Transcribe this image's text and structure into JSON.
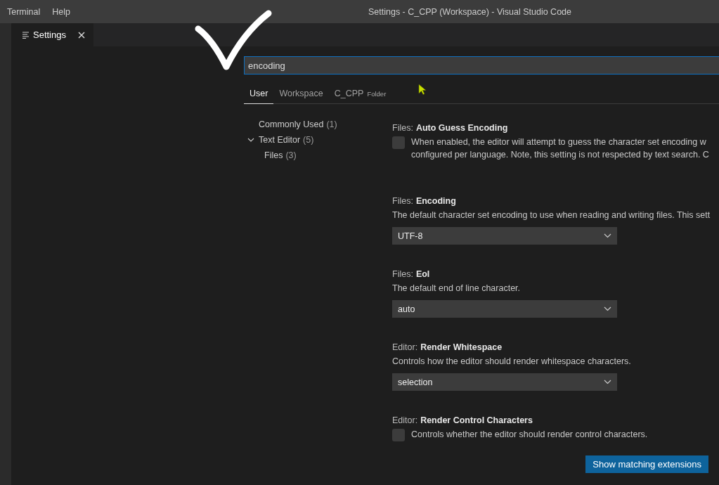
{
  "window": {
    "title": "Settings - C_CPP (Workspace) - Visual Studio Code"
  },
  "menu": [
    "Terminal",
    "Help"
  ],
  "editor_tabs": [
    {
      "label": "Settings",
      "selected": true
    }
  ],
  "search": {
    "value": "encoding"
  },
  "scope_tabs": [
    {
      "label": "User",
      "selected": true
    },
    {
      "label": "Workspace",
      "selected": false
    },
    {
      "label": "C_CPP",
      "badge": "Folder",
      "selected": false
    }
  ],
  "toc": [
    {
      "label": "Commonly Used",
      "count": "(1)"
    },
    {
      "label": "Text Editor",
      "count": "(5)",
      "expanded": true,
      "children": [
        {
          "label": "Files",
          "count": "(3)"
        }
      ]
    }
  ],
  "settings": [
    {
      "kind": "checkbox",
      "category": "Files:",
      "name": "Auto Guess Encoding",
      "description": "When enabled, the editor will attempt to guess the character set encoding w configured per language. Note, this setting is not respected by text search. C",
      "checked": false
    },
    {
      "kind": "dropdown",
      "category": "Files:",
      "name": "Encoding",
      "description": "The default character set encoding to use when reading and writing files. This sett",
      "value": "UTF-8"
    },
    {
      "kind": "dropdown",
      "category": "Files:",
      "name": "Eol",
      "description": "The default end of line character.",
      "value": "auto"
    },
    {
      "kind": "dropdown",
      "category": "Editor:",
      "name": "Render Whitespace",
      "description": "Controls how the editor should render whitespace characters.",
      "value": "selection"
    },
    {
      "kind": "checkbox",
      "category": "Editor:",
      "name": "Render Control Characters",
      "description": "Controls whether the editor should render control characters.",
      "checked": false
    }
  ],
  "button": "Show matching extensions"
}
